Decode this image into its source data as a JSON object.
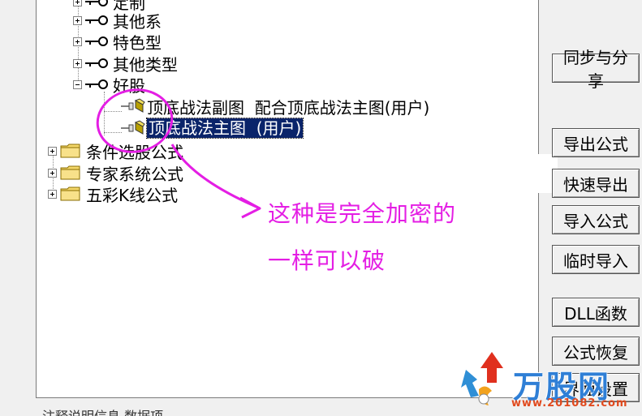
{
  "tree": {
    "items": [
      {
        "label": "定制"
      },
      {
        "label": "其他系"
      },
      {
        "label": "特色型"
      },
      {
        "label": "其他类型"
      },
      {
        "label": "好股"
      },
      {
        "label": "顶底战法副图  配合顶底战法主图(用户)"
      },
      {
        "label": "顶底战法主图  (用户)"
      },
      {
        "label": "条件选股公式"
      },
      {
        "label": "专家系统公式"
      },
      {
        "label": "五彩K线公式"
      }
    ]
  },
  "buttons": {
    "sync_share": "同步与分享",
    "export_formula": "导出公式",
    "quick_export": "快速导出",
    "import_formula": "导入公式",
    "temp_import": "临时导入",
    "dll_function": "DLL函数",
    "formula_restore": "公式恢复",
    "interface_settings": "界面设置"
  },
  "annotation": {
    "line1": "这种是完全加密的",
    "line2": "一样可以破",
    "color": "#e41ee4"
  },
  "bottom": {
    "text": "注释说明信息 数据项"
  },
  "watermark": {
    "brand": "万股网",
    "url": "www.201082.com"
  }
}
